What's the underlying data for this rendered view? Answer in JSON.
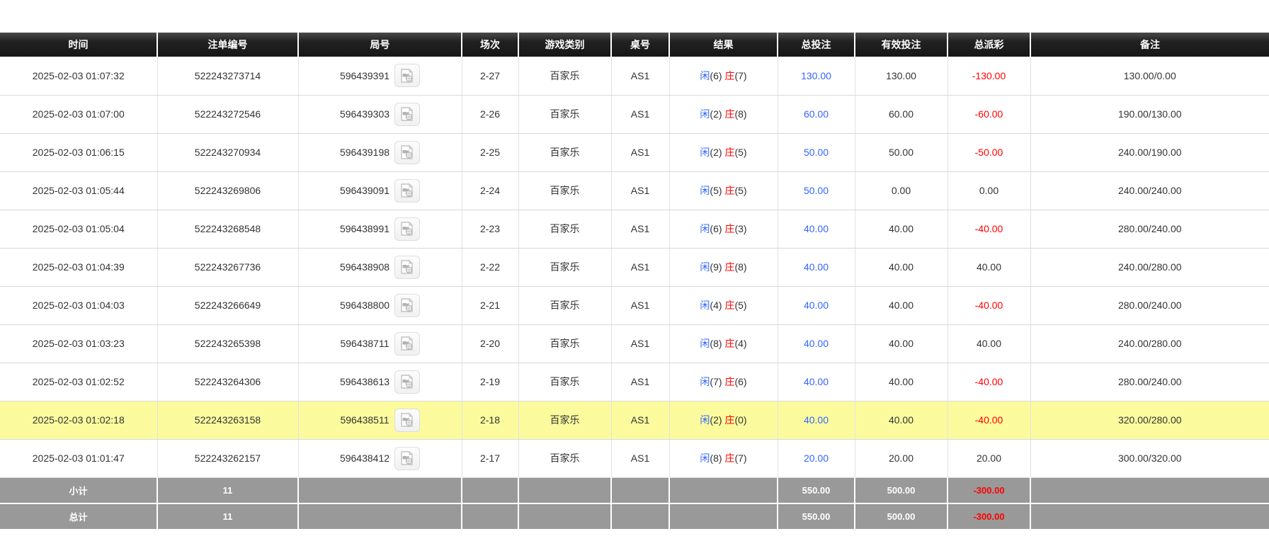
{
  "colors": {
    "header_bg": "#1f1f1f",
    "accent_blue": "#3366ff",
    "negative_red": "#ff0000",
    "highlight_yellow": "#fbfb9e",
    "footer_grey": "#999999"
  },
  "icons": {
    "video_replay": "video-replay-icon"
  },
  "table": {
    "columns": [
      {
        "key": "time",
        "label": "时间"
      },
      {
        "key": "bet_id",
        "label": "注单编号"
      },
      {
        "key": "round",
        "label": "局号"
      },
      {
        "key": "session",
        "label": "场次"
      },
      {
        "key": "game_type",
        "label": "游戏类别"
      },
      {
        "key": "table_no",
        "label": "桌号"
      },
      {
        "key": "result",
        "label": "结果"
      },
      {
        "key": "total_bet",
        "label": "总投注"
      },
      {
        "key": "valid_bet",
        "label": "有效投注"
      },
      {
        "key": "payout",
        "label": "总派彩"
      },
      {
        "key": "remark",
        "label": "备注"
      }
    ],
    "rows": [
      {
        "time": "2025-02-03 01:07:32",
        "bet_id": "522243273714",
        "round": "596439391",
        "session": "2-27",
        "game_type": "百家乐",
        "table_no": "AS1",
        "result": {
          "player": "闲",
          "player_points": "(6)",
          "banker": "庄",
          "banker_points": "(7)"
        },
        "total_bet": "130.00",
        "valid_bet": "130.00",
        "payout": "-130.00",
        "remark": "130.00/0.00",
        "highlighted": false
      },
      {
        "time": "2025-02-03 01:07:00",
        "bet_id": "522243272546",
        "round": "596439303",
        "session": "2-26",
        "game_type": "百家乐",
        "table_no": "AS1",
        "result": {
          "player": "闲",
          "player_points": "(2)",
          "banker": "庄",
          "banker_points": "(8)"
        },
        "total_bet": "60.00",
        "valid_bet": "60.00",
        "payout": "-60.00",
        "remark": "190.00/130.00",
        "highlighted": false
      },
      {
        "time": "2025-02-03 01:06:15",
        "bet_id": "522243270934",
        "round": "596439198",
        "session": "2-25",
        "game_type": "百家乐",
        "table_no": "AS1",
        "result": {
          "player": "闲",
          "player_points": "(2)",
          "banker": "庄",
          "banker_points": "(5)"
        },
        "total_bet": "50.00",
        "valid_bet": "50.00",
        "payout": "-50.00",
        "remark": "240.00/190.00",
        "highlighted": false
      },
      {
        "time": "2025-02-03 01:05:44",
        "bet_id": "522243269806",
        "round": "596439091",
        "session": "2-24",
        "game_type": "百家乐",
        "table_no": "AS1",
        "result": {
          "player": "闲",
          "player_points": "(5)",
          "banker": "庄",
          "banker_points": "(5)"
        },
        "total_bet": "50.00",
        "valid_bet": "0.00",
        "payout": "0.00",
        "remark": "240.00/240.00",
        "highlighted": false
      },
      {
        "time": "2025-02-03 01:05:04",
        "bet_id": "522243268548",
        "round": "596438991",
        "session": "2-23",
        "game_type": "百家乐",
        "table_no": "AS1",
        "result": {
          "player": "闲",
          "player_points": "(6)",
          "banker": "庄",
          "banker_points": "(3)"
        },
        "total_bet": "40.00",
        "valid_bet": "40.00",
        "payout": "-40.00",
        "remark": "280.00/240.00",
        "highlighted": false
      },
      {
        "time": "2025-02-03 01:04:39",
        "bet_id": "522243267736",
        "round": "596438908",
        "session": "2-22",
        "game_type": "百家乐",
        "table_no": "AS1",
        "result": {
          "player": "闲",
          "player_points": "(9)",
          "banker": "庄",
          "banker_points": "(8)"
        },
        "total_bet": "40.00",
        "valid_bet": "40.00",
        "payout": "40.00",
        "remark": "240.00/280.00",
        "highlighted": false
      },
      {
        "time": "2025-02-03 01:04:03",
        "bet_id": "522243266649",
        "round": "596438800",
        "session": "2-21",
        "game_type": "百家乐",
        "table_no": "AS1",
        "result": {
          "player": "闲",
          "player_points": "(4)",
          "banker": "庄",
          "banker_points": "(5)"
        },
        "total_bet": "40.00",
        "valid_bet": "40.00",
        "payout": "-40.00",
        "remark": "280.00/240.00",
        "highlighted": false
      },
      {
        "time": "2025-02-03 01:03:23",
        "bet_id": "522243265398",
        "round": "596438711",
        "session": "2-20",
        "game_type": "百家乐",
        "table_no": "AS1",
        "result": {
          "player": "闲",
          "player_points": "(8)",
          "banker": "庄",
          "banker_points": "(4)"
        },
        "total_bet": "40.00",
        "valid_bet": "40.00",
        "payout": "40.00",
        "remark": "240.00/280.00",
        "highlighted": false
      },
      {
        "time": "2025-02-03 01:02:52",
        "bet_id": "522243264306",
        "round": "596438613",
        "session": "2-19",
        "game_type": "百家乐",
        "table_no": "AS1",
        "result": {
          "player": "闲",
          "player_points": "(7)",
          "banker": "庄",
          "banker_points": "(6)"
        },
        "total_bet": "40.00",
        "valid_bet": "40.00",
        "payout": "-40.00",
        "remark": "280.00/240.00",
        "highlighted": false
      },
      {
        "time": "2025-02-03 01:02:18",
        "bet_id": "522243263158",
        "round": "596438511",
        "session": "2-18",
        "game_type": "百家乐",
        "table_no": "AS1",
        "result": {
          "player": "闲",
          "player_points": "(2)",
          "banker": "庄",
          "banker_points": "(0)"
        },
        "total_bet": "40.00",
        "valid_bet": "40.00",
        "payout": "-40.00",
        "remark": "320.00/280.00",
        "highlighted": true
      },
      {
        "time": "2025-02-03 01:01:47",
        "bet_id": "522243262157",
        "round": "596438412",
        "session": "2-17",
        "game_type": "百家乐",
        "table_no": "AS1",
        "result": {
          "player": "闲",
          "player_points": "(8)",
          "banker": "庄",
          "banker_points": "(7)"
        },
        "total_bet": "20.00",
        "valid_bet": "20.00",
        "payout": "20.00",
        "remark": "300.00/320.00",
        "highlighted": false
      }
    ],
    "footer": [
      {
        "label": "小计",
        "count": "11",
        "total_bet": "550.00",
        "valid_bet": "500.00",
        "payout": "-300.00",
        "remark": ""
      },
      {
        "label": "总计",
        "count": "11",
        "total_bet": "550.00",
        "valid_bet": "500.00",
        "payout": "-300.00",
        "remark": ""
      }
    ]
  }
}
